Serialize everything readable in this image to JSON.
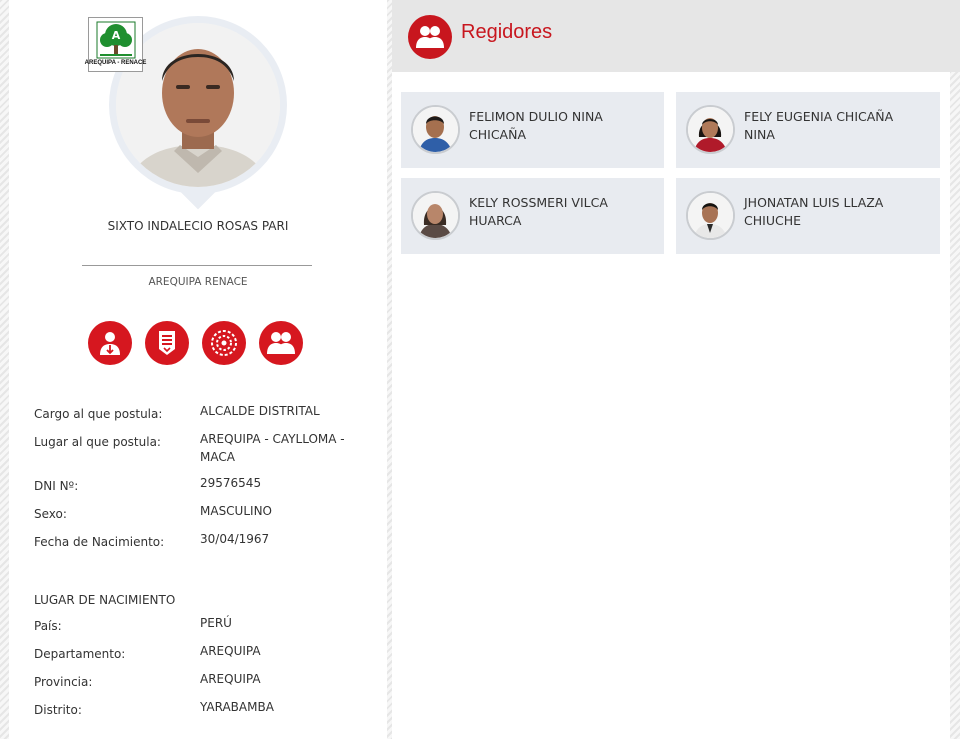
{
  "candidate": {
    "name": "SIXTO INDALECIO ROSAS PARI",
    "organization": "AREQUIPA RENACE",
    "party_logo_text": "AREQUIPA - RENACE"
  },
  "actions": [
    {
      "icon": "download-profile-icon"
    },
    {
      "icon": "document-download-icon"
    },
    {
      "icon": "plan-icon"
    },
    {
      "icon": "regidores-icon"
    }
  ],
  "details": [
    {
      "label": "Cargo al que postula:",
      "value": "ALCALDE DISTRITAL"
    },
    {
      "label": "Lugar al que postula:",
      "value": "AREQUIPA - CAYLLOMA - MACA"
    },
    {
      "label": "DNI Nº:",
      "value": "29576545"
    },
    {
      "label": "Sexo:",
      "value": "MASCULINO"
    },
    {
      "label": "Fecha de Nacimiento:",
      "value": "30/04/1967"
    }
  ],
  "birthplace": {
    "title": "LUGAR DE NACIMIENTO",
    "rows": [
      {
        "label": "País:",
        "value": "PERÚ"
      },
      {
        "label": "Departamento:",
        "value": "AREQUIPA"
      },
      {
        "label": "Provincia:",
        "value": "AREQUIPA"
      },
      {
        "label": "Distrito:",
        "value": "YARABAMBA"
      }
    ]
  },
  "regidores": {
    "title": "Regidores",
    "members": [
      {
        "name": "FELIMON DULIO NINA CHICAÑA"
      },
      {
        "name": "FELY EUGENIA CHICAÑA NINA"
      },
      {
        "name": "KELY ROSSMERI VILCA HUARCA"
      },
      {
        "name": "JHONATAN LUIS LLAZA CHIUCHE"
      }
    ]
  },
  "colors": {
    "accent": "#d6171f",
    "header_bg": "#e6e6e6",
    "card_bg": "#e8ebf0"
  }
}
